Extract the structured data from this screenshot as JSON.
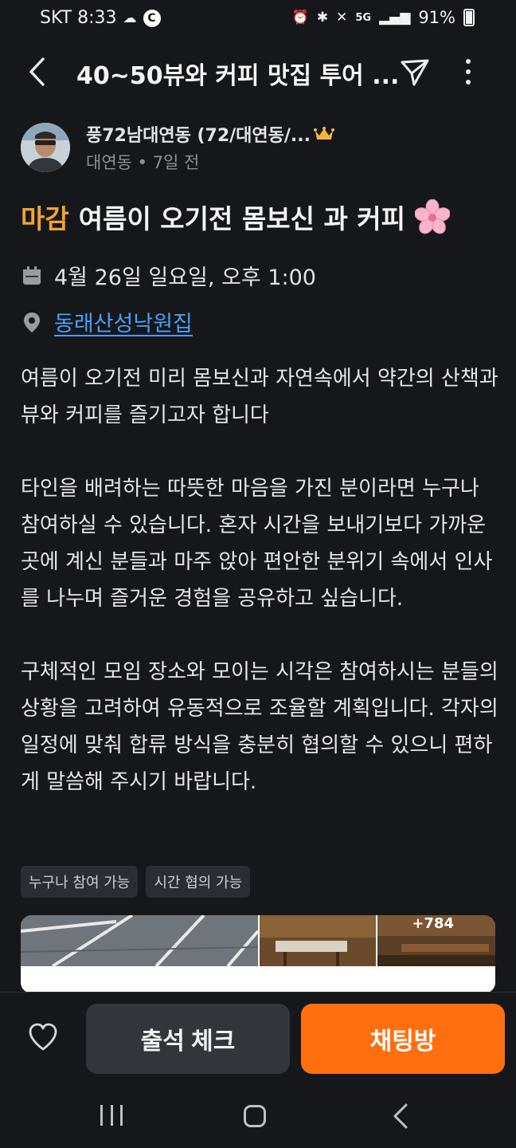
{
  "status_bar": {
    "carrier_time": "SKT 8:33",
    "app_icon": "C",
    "network": "5G",
    "battery": "91%"
  },
  "header": {
    "title": "40~50뷰와 커피 맛집 투어 ..."
  },
  "author": {
    "name": "풍72남대연동 (72/대연동/...",
    "meta": "대연동 • 7일 전"
  },
  "post": {
    "status_badge": "마감",
    "title": "여름이 오기전 몸보신 과 커피",
    "date": "4월 26일 일요일, 오후 1:00",
    "place": "동래산성낙원집",
    "paragraphs": [
      "여름이 오기전 미리 몸보신과 자연속에서 약간의 산책과 뷰와 커피를 즐기고자 합니다",
      "타인을 배려하는 따뜻한 마음을 가진 분이라면 누구나 참여하실 수 있습니다. 혼자 시간을 보내기보다 가까운 곳에 계신 분들과 마주 앉아 편안한 분위기 속에서 인사를 나누며 즐거운 경험을 공유하고 싶습니다.",
      "구체적인 모임 장소와 모이는 시각은 참여하시는 분들의 상황을 고려하여 유동적으로 조율할 계획입니다. 각자의 일정에 맞춰 합류 방식을 충분히 협의할 수 있으니 편하게 말씀해 주시기 바랍니다."
    ],
    "tags": [
      "누구나 참여 가능",
      "시간 협의 가능"
    ],
    "photo_more": "+784"
  },
  "actions": {
    "attend_label": "출석 체크",
    "chat_label": "채팅방"
  },
  "colors": {
    "background": "#16171b",
    "accent": "#ff6f0f",
    "closed_badge": "#f0a530",
    "link": "#4a9ff5"
  },
  "icons": {
    "back": "chevron-left-icon",
    "share": "paper-plane-icon",
    "more": "more-vertical-icon",
    "crown": "crown-icon",
    "flower": "cherry-blossom-icon",
    "date": "calendar-icon",
    "place": "location-pin-icon",
    "like": "heart-icon"
  }
}
